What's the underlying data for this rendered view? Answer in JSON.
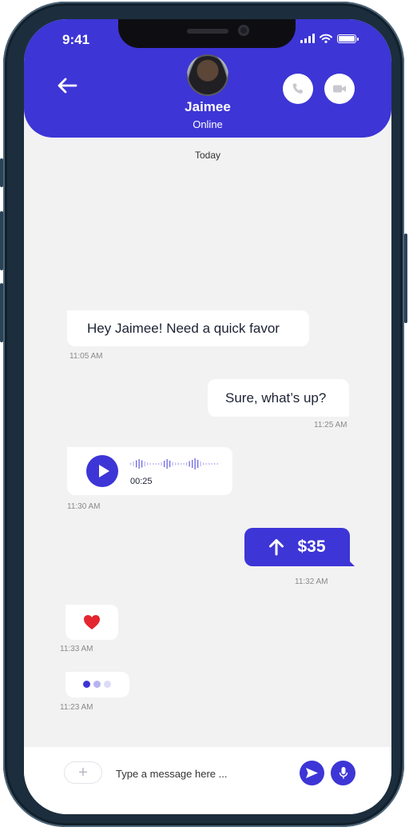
{
  "status_bar": {
    "time": "9:41"
  },
  "header": {
    "contact_name": "Jaimee",
    "contact_status": "Online",
    "back_icon": "arrow-left-icon",
    "call_icon": "phone-icon",
    "video_icon": "video-camera-icon",
    "accent_color": "#3d35d6"
  },
  "chat": {
    "date_divider": "Today",
    "messages": [
      {
        "direction": "incoming",
        "type": "text",
        "text": "Hey Jaimee! Need a quick favor",
        "time": "11:05 AM"
      },
      {
        "direction": "outgoing",
        "type": "text",
        "text": "Sure, what’s up?",
        "time": "11:25 AM"
      },
      {
        "direction": "incoming",
        "type": "voice",
        "duration": "00:25",
        "time": "11:30 AM"
      },
      {
        "direction": "outgoing",
        "type": "payment",
        "amount": "$35",
        "icon": "arrow-up-icon",
        "time": "11:32 AM"
      },
      {
        "direction": "incoming",
        "type": "emoji",
        "emoji": "❤️",
        "time": "11:33 AM"
      },
      {
        "direction": "incoming",
        "type": "typing",
        "time": "11:23 AM"
      }
    ]
  },
  "composer": {
    "add_label": "+",
    "placeholder": "Type a message here ...",
    "send_icon": "send-icon",
    "mic_icon": "microphone-icon"
  }
}
